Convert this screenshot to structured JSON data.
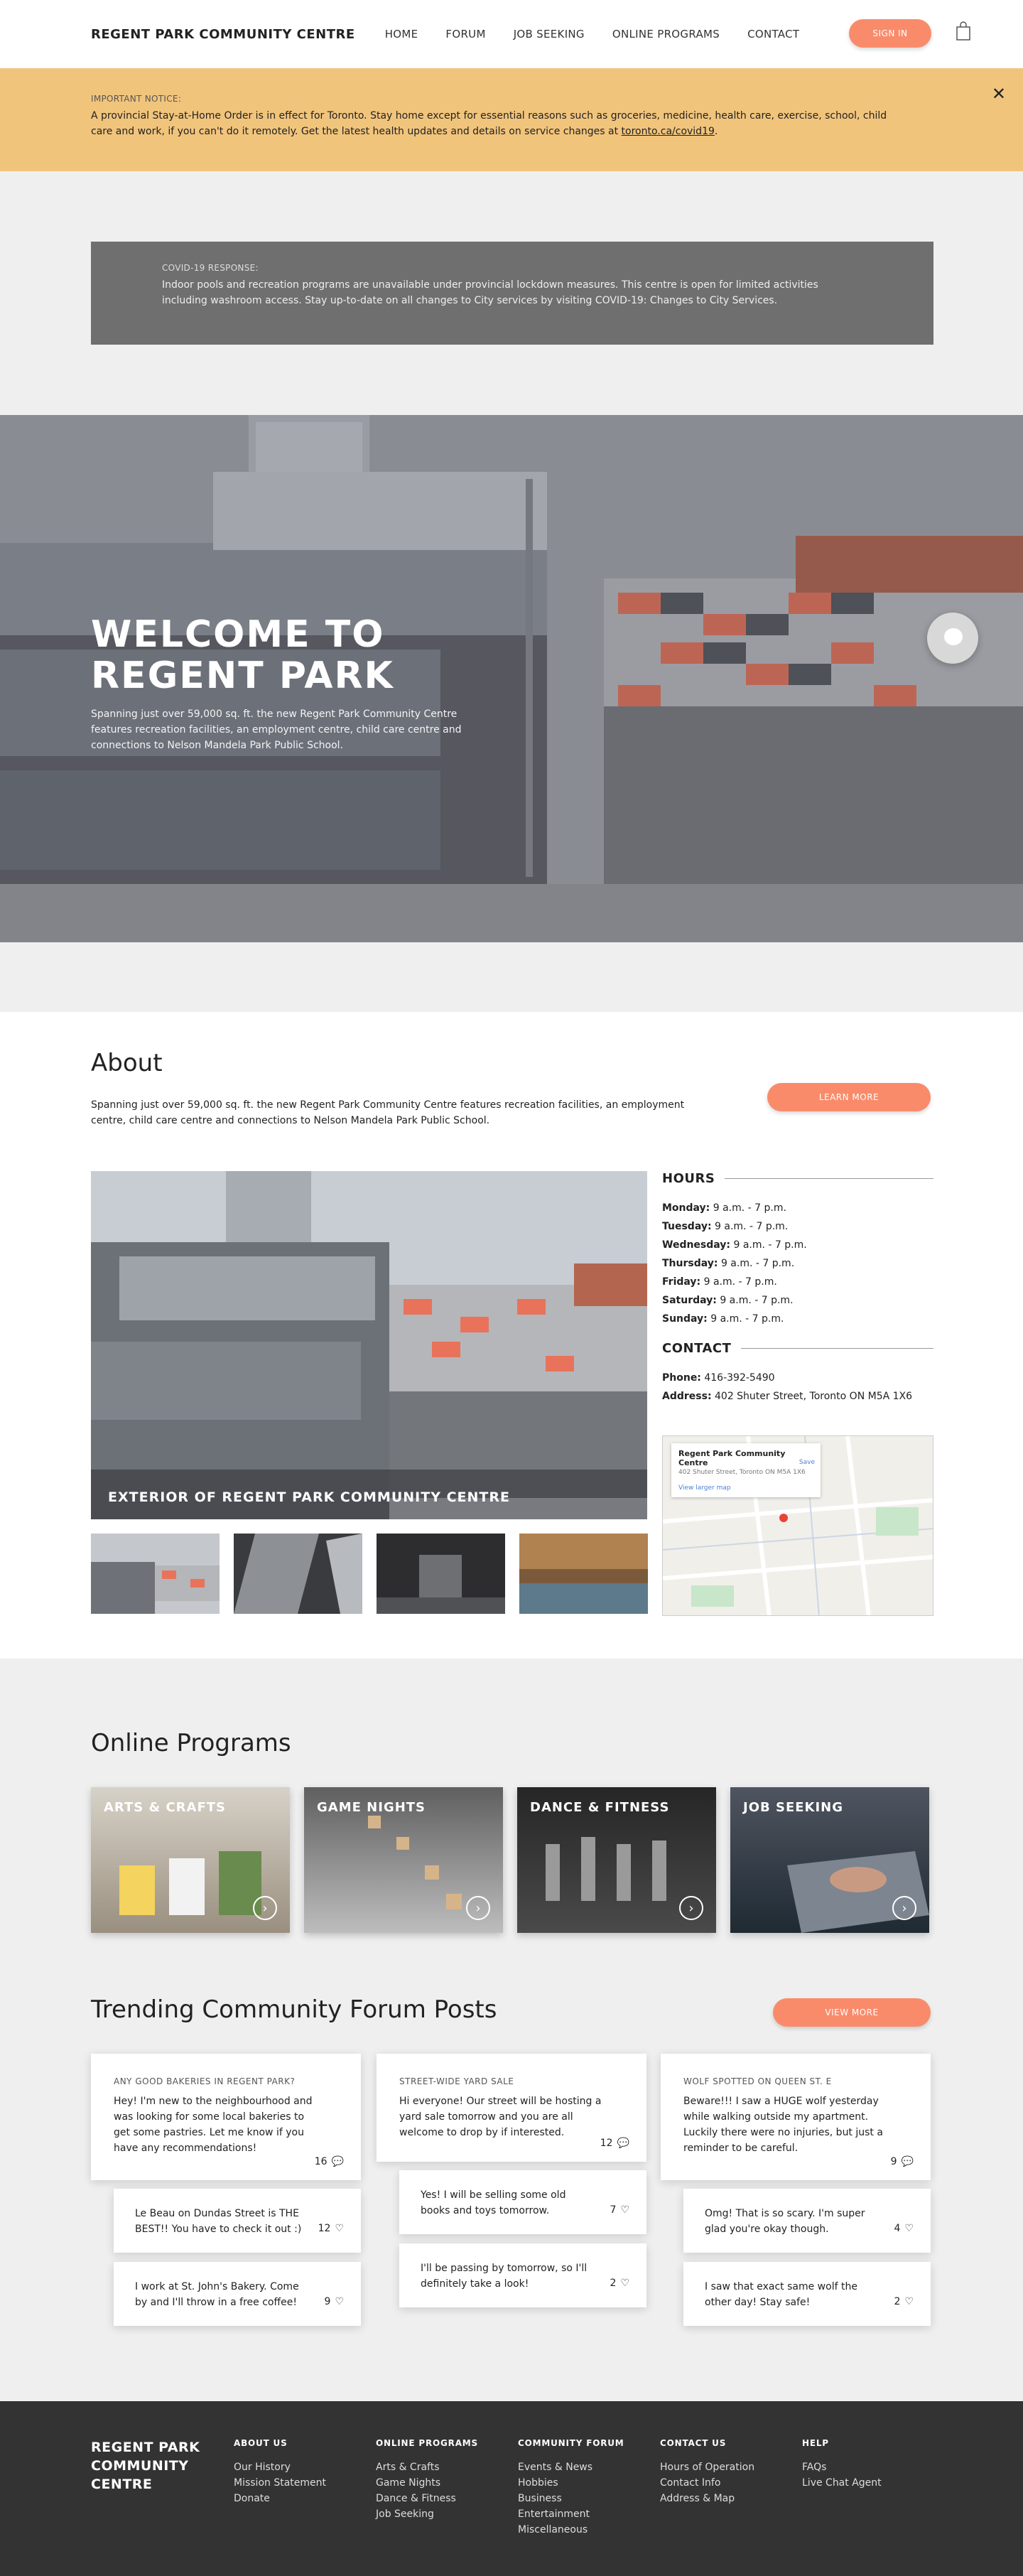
{
  "header": {
    "brand": "REGENT PARK COMMUNITY CENTRE",
    "nav": [
      "HOME",
      "FORUM",
      "JOB SEEKING",
      "ONLINE PROGRAMS",
      "CONTACT"
    ],
    "sign_in": "SIGN IN",
    "cart_icon": "shopping-bag-icon"
  },
  "notice": {
    "title": "IMPORTANT NOTICE:",
    "body": "A provincial Stay-at-Home Order is in effect for Toronto. Stay home except for essential reasons such as groceries, medicine, health care, exercise, school, child care and work, if you can't do it remotely. Get the latest health updates and details on service changes at ",
    "link": "toronto.ca/covid19",
    "end": ".",
    "close": "✕"
  },
  "covid": {
    "title": "COVID-19 RESPONSE:",
    "body": "Indoor pools and recreation programs are unavailable under provincial lockdown measures. This centre is open for limited activities including washroom access. Stay up-to-date on all changes to City services by visiting COVID-19: Changes to City Services."
  },
  "hero": {
    "title": "WELCOME TO REGENT PARK",
    "subtitle": "Spanning just over 59,000 sq. ft. the new Regent Park Community Centre features recreation facilities, an employment centre, child care centre and connections to Nelson Mandela Park Public School."
  },
  "about": {
    "title": "About",
    "desc": "Spanning just over 59,000 sq. ft. the new Regent Park Community Centre features recreation facilities, an employment centre, child care centre and connections to Nelson Mandela Park Public School.",
    "learn_more": "LEARN MORE",
    "image_caption": "EXTERIOR OF REGENT PARK COMMUNITY CENTRE",
    "hours_title": "HOURS",
    "hours": [
      {
        "day": "Monday:",
        "time": "9 a.m. - 7 p.m."
      },
      {
        "day": "Tuesday:",
        "time": "9 a.m. - 7 p.m."
      },
      {
        "day": "Wednesday:",
        "time": "9 a.m. - 7 p.m."
      },
      {
        "day": "Thursday:",
        "time": "9 a.m. - 7 p.m."
      },
      {
        "day": "Friday:",
        "time": "9 a.m. - 7 p.m."
      },
      {
        "day": "Saturday:",
        "time": "9 a.m. - 7 p.m."
      },
      {
        "day": "Sunday:",
        "time": "9 a.m. - 7 p.m."
      }
    ],
    "contact_title": "CONTACT",
    "phone_label": "Phone:",
    "phone": "416-392-5490",
    "address_label": "Address:",
    "address": "402 Shuter Street, Toronto ON M5A 1X6",
    "map": {
      "place": "Regent Park Community Centre",
      "addr": "402 Shuter Street, Toronto ON M5A 1X6",
      "larger": "View larger map",
      "save": "Save"
    }
  },
  "programs": {
    "title": "Online Programs",
    "items": [
      "ARTS & CRAFTS",
      "GAME NIGHTS",
      "DANCE & FITNESS",
      "JOB SEEKING"
    ]
  },
  "forum": {
    "title": "Trending Community Forum Posts",
    "view_more": "VIEW MORE",
    "posts": [
      {
        "title": "ANY GOOD BAKERIES IN REGENT PARK?",
        "body": "Hey! I'm new to the neighbourhood and was looking for some local bakeries to get some pastries. Let me know if you have any recommendations!",
        "count": "16",
        "replies": [
          {
            "body": "Le Beau on Dundas Street is THE BEST!! You have to check it out :)",
            "count": "12"
          },
          {
            "body": "I work at St. John's Bakery. Come by and I'll throw in a free coffee!",
            "count": "9"
          }
        ]
      },
      {
        "title": "STREET-WIDE YARD SALE",
        "body": "Hi everyone! Our street will be hosting a yard sale tomorrow and you are all welcome to drop by if interested.",
        "count": "12",
        "replies": [
          {
            "body": "Yes! I will be selling some old books and toys tomorrow.",
            "count": "7"
          },
          {
            "body": "I'll be passing by tomorrow, so I'll definitely take a look!",
            "count": "2"
          }
        ]
      },
      {
        "title": "WOLF SPOTTED ON QUEEN ST. E",
        "body": "Beware!!! I saw a HUGE wolf yesterday while walking outside my apartment. Luckily there were no injuries, but just a reminder to be careful.",
        "count": "9",
        "replies": [
          {
            "body": "Omg! That is so scary. I'm super glad you're okay though.",
            "count": "4"
          },
          {
            "body": "I saw that exact same wolf the other day! Stay safe!",
            "count": "2"
          }
        ]
      }
    ]
  },
  "footer": {
    "brand": "REGENT PARK COMMUNITY CENTRE",
    "cols": [
      {
        "h": "ABOUT US",
        "items": [
          "Our History",
          "Mission Statement",
          "Donate"
        ]
      },
      {
        "h": "ONLINE PROGRAMS",
        "items": [
          "Arts & Crafts",
          "Game Nights",
          "Dance & Fitness",
          "Job Seeking"
        ]
      },
      {
        "h": "COMMUNITY FORUM",
        "items": [
          "Events & News",
          "Hobbies",
          "Business",
          "Entertainment",
          "Miscellaneous"
        ]
      },
      {
        "h": "CONTACT US",
        "items": [
          "Hours of Operation",
          "Contact Info",
          "Address & Map"
        ]
      },
      {
        "h": "HELP",
        "items": [
          "FAQs",
          "Live Chat Agent"
        ]
      }
    ]
  },
  "colors": {
    "accent": "#f98b6b",
    "notice": "#f1c47c",
    "covid_box": "#6f6f6f",
    "footer": "#333333"
  }
}
